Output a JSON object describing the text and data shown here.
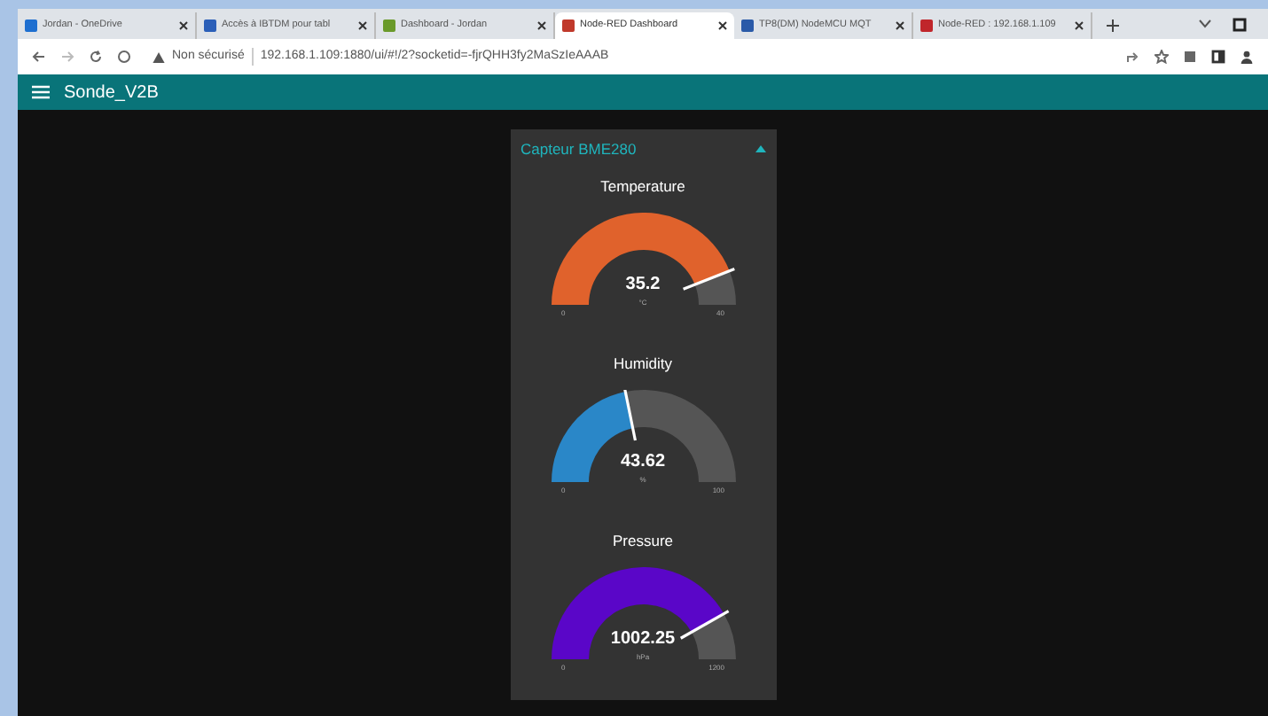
{
  "browser": {
    "tabs": [
      {
        "label": "Jordan - OneDrive",
        "selected": false,
        "color": "#1e6fd0"
      },
      {
        "label": "Accès à IBTDM pour tabl",
        "selected": false,
        "color": "#2b5fb8"
      },
      {
        "label": "Dashboard - Jordan",
        "selected": false,
        "color": "#6a9a2a"
      },
      {
        "label": "Node-RED Dashboard",
        "selected": true,
        "color": "#c0392b"
      },
      {
        "label": "TP8(DM) NodeMCU MQT",
        "selected": false,
        "color": "#2a5aa8"
      },
      {
        "label": "Node-RED : 192.168.1.109",
        "selected": false,
        "color": "#c0262b"
      }
    ],
    "security": "Non sécurisé",
    "url": "192.168.1.109:1880/ui/#!/2?socketid=-fjrQHH3fy2MaSzIeAAAB"
  },
  "header": {
    "title": "Sonde_V2B"
  },
  "group": {
    "title": "Capteur BME280",
    "expanded": true,
    "gauges": [
      {
        "title": "Temperature",
        "value": "35.2",
        "unit": "°C",
        "min": "0",
        "max": "40",
        "color": "#e0622c"
      },
      {
        "title": "Humidity",
        "value": "43.62",
        "unit": "%",
        "min": "0",
        "max": "100",
        "color": "#2a87c8"
      },
      {
        "title": "Pressure",
        "value": "1002.25",
        "unit": "hPa",
        "min": "0",
        "max": "1200",
        "color": "#5a06c8"
      }
    ]
  }
}
